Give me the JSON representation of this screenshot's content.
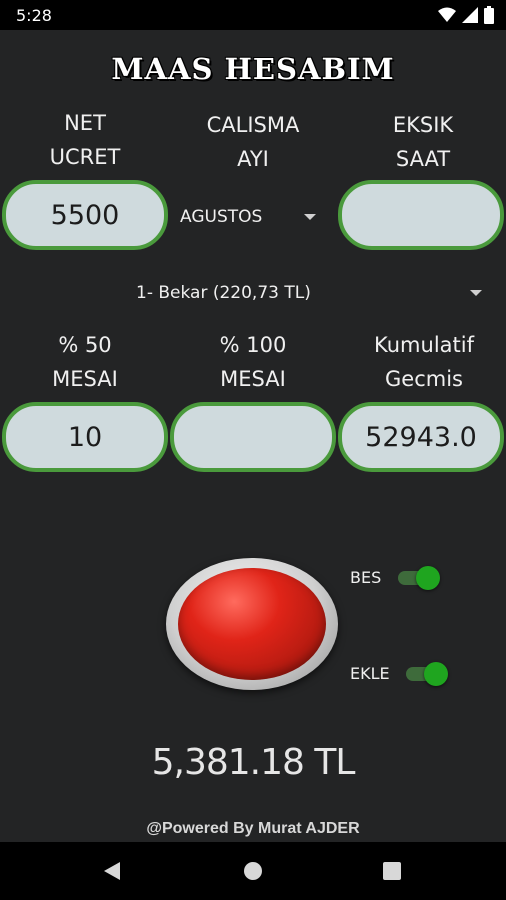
{
  "status_bar": {
    "time": "5:28"
  },
  "app": {
    "title": "MAAS HESABIM",
    "labels": {
      "net_ucret": [
        "NET",
        "UCRET"
      ],
      "calisma_ayi": [
        "CALISMA",
        "AYI"
      ],
      "eksik_saat": [
        "EKSIK",
        "SAAT"
      ],
      "mesai_50": [
        "% 50",
        "MESAI"
      ],
      "mesai_100": [
        "% 100",
        "MESAI"
      ],
      "kumulatif": [
        "Kumulatif",
        "Gecmis"
      ]
    },
    "fields": {
      "net_ucret": "5500",
      "eksik_saat": "",
      "mesai_50": "10",
      "mesai_100": "",
      "kumulatif": "52943.0"
    },
    "month_select": "AGUSTOS",
    "status_select": "1- Bekar (220,73 TL)",
    "switches": {
      "bes": {
        "label": "BES",
        "on": true
      },
      "ekle": {
        "label": "EKLE",
        "on": true
      }
    },
    "result": "5,381.18 TL",
    "footer": "@Powered By Murat AJDER"
  },
  "colors": {
    "background": "#232425",
    "field_fill": "#cfdadd",
    "field_border": "#4a9a3c",
    "switch_on": "#1fa51f",
    "button_red": "#e02418"
  },
  "icons": {
    "status": [
      "wifi-icon",
      "signal-icon",
      "battery-icon"
    ],
    "nav": [
      "back-icon",
      "home-icon",
      "recents-icon"
    ]
  }
}
